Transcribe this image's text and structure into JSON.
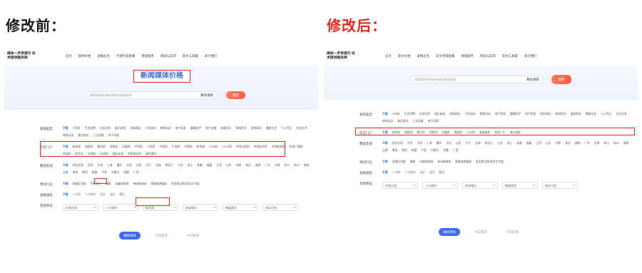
{
  "captions": {
    "before": "修改前：",
    "after": "修改后："
  },
  "before": {
    "logo": "媒体一手资源方 技术提供服务商",
    "nav": [
      "首页",
      "媒体价格",
      "发稿业务",
      "代理代发套餐",
      "增值服务",
      "帮助与支持",
      "软文工具箱",
      "关于我们"
    ],
    "hero_title": "新闻媒体价格",
    "search_placeholder": "搜索媒体名称或关键词查找媒体",
    "search_select": "精准搜索",
    "search_button": "搜索",
    "filters": [
      {
        "label": "频道类型:",
        "items": [
          "不限",
          "IT科技",
          "生活消费",
          "文化时尚",
          "娱乐体育",
          "游戏网站",
          "汽车网站",
          "教育培训",
          "房产家居",
          "健康医疗",
          "财产金融",
          "旅游出行",
          "新闻资讯",
          "游戏网站",
          "最新社会",
          "十元专区",
          "文化艺术",
          "体育运动",
          "备品餐饮",
          "工业质量",
          "亲子母婴"
        ]
      },
      {
        "label": "综合门户:",
        "items": [
          "不限",
          "新浪网",
          "搜狐网",
          "腾讯网",
          "网易网",
          "凤凰网",
          "中华网",
          "人民网",
          "中国网",
          "千龙网",
          "中国网",
          "新华网",
          "TOM网",
          "21CN网",
          "中国日报网",
          "中国经济网",
          "中国新闻网",
          "中国广播网",
          "央视网",
          "新华社",
          "光明网",
          "环球网",
          "国际在线",
          "中国青年网",
          "海外媒体"
        ]
      },
      {
        "label": "覆盖区域:",
        "items": [
          "不限",
          "综合全国",
          "北京",
          "天津",
          "上海",
          "重庆",
          "河北",
          "山西",
          "辽宁",
          "吉林",
          "黑龙江",
          "江苏",
          "浙江",
          "安徽",
          "福建",
          "江西",
          "山东",
          "河南",
          "湖北",
          "湖南",
          "广东",
          "甘肃",
          "四川",
          "贵州",
          "海南",
          "云南",
          "青海",
          "陕西",
          "新疆",
          "宁夏",
          "内蒙古",
          "西藏",
          "广西"
        ]
      },
      {
        "label": "特别行业:",
        "items": [
          "不限",
          "金融区块链",
          "写新闻社",
          "健康",
          "自媒体来源",
          "带动新媒体",
          "需要来源媒体",
          "首页焦点图/首页文字链"
        ]
      },
      {
        "label": "发稿速度:",
        "items": [
          "不限",
          "一小时",
          "二小时内",
          "当天",
          "当天",
          "两天"
        ]
      }
    ],
    "other_label": "其他筛选:",
    "selects": [
      "价格分类",
      "人口规则",
      "新闻源",
      "收录情况",
      "稿媒类型",
      "周末可发"
    ],
    "bottom_buttons": [
      "媒体查找",
      "今日需求",
      "今日新增"
    ]
  },
  "after": {
    "logo": "媒体一手资源方 技术提供服务商",
    "nav": [
      "首页",
      "软文价格",
      "发稿业务",
      "软文营销套餐",
      "增值服务",
      "帮助与支持",
      "软文工具箱",
      "关于我们"
    ],
    "search_placeholder": "搜索媒体名称或关键词查找媒体",
    "search_select": "精准搜索",
    "search_button": "搜索",
    "filters": [
      {
        "label": "频道类型:",
        "items": [
          "不限",
          "IT科技",
          "生活消费",
          "文化时尚",
          "娱乐体育",
          "游戏网站",
          "汽车网站",
          "教育培训",
          "房产家居",
          "健康医疗",
          "房产家居",
          "财经商业",
          "新闻资讯",
          "游戏网站",
          "最新社会",
          "十元专区",
          "文化艺术",
          "体育运动",
          "备品餐饮",
          "工业质量",
          "亲子母婴"
        ]
      },
      {
        "label": "综合门户:",
        "items": [
          "不限",
          "新浪网",
          "搜狐网",
          "腾讯网",
          "网易网",
          "凤凰网",
          "搜狐网",
          "TOM网",
          "备案媒体",
          "其他门户",
          "海外媒体"
        ]
      },
      {
        "label": "覆盖区域:",
        "items": [
          "不限",
          "综合全国",
          "北京",
          "天津",
          "上海",
          "重庆",
          "河北",
          "山西",
          "辽宁",
          "吉林",
          "黑龙江",
          "江苏",
          "浙江",
          "安徽",
          "福建",
          "江西",
          "山东",
          "河南",
          "湖北",
          "湖南",
          "广东",
          "甘肃",
          "四川",
          "贵州",
          "海南",
          "云南",
          "青海",
          "陕西",
          "新疆",
          "宁夏",
          "内蒙古",
          "西藏",
          "广西"
        ]
      },
      {
        "label": "特别行业:",
        "items": [
          "不限",
          "金融区块链",
          "健康",
          "自媒体来源",
          "带动新媒体",
          "需要来源媒体",
          "首页焦点图/首页文字链"
        ]
      },
      {
        "label": "发稿速度:",
        "items": [
          "不限",
          "一小时",
          "二小时内",
          "当天",
          "当天",
          "两天"
        ]
      }
    ],
    "other_label": "其他筛选:",
    "selects": [
      "价格分类",
      "人口规则",
      "收录情况",
      "稿媒类型",
      "周末可发"
    ],
    "bottom_buttons": [
      "媒体查找",
      "今日需求",
      "今日新增"
    ]
  }
}
